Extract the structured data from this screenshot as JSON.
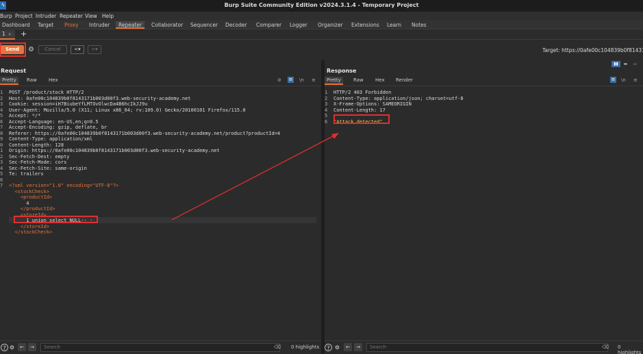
{
  "window": {
    "title": "Burp Suite Community Edition v2024.3.1.4 - Temporary Project"
  },
  "menu": [
    "Burp",
    "Project",
    "Intruder",
    "Repeater",
    "View",
    "Help"
  ],
  "tool_tabs": [
    "Dashboard",
    "Target",
    "Proxy",
    "Intruder",
    "Repeater",
    "Collaborator",
    "Sequencer",
    "Decoder",
    "Comparer",
    "Logger",
    "Organizer",
    "Extensions",
    "Learn",
    "Notes"
  ],
  "repeater": {
    "tab_label": "1",
    "tab_close": "×",
    "new_tab": "+"
  },
  "toolbar": {
    "send_label": "Send",
    "cancel_label": "Cancel",
    "back_label": "<▾",
    "forward_label": ">▾",
    "target": "Target: https://0afe00c104839b0f8143171b003"
  },
  "request": {
    "title": "Request",
    "tabs": [
      "Pretty",
      "Raw",
      "Hex"
    ],
    "lines": [
      {
        "n": "1",
        "t": "POST /product/stock HTTP/2"
      },
      {
        "n": "2",
        "t": "Host: 0afe00c104839b0f8143171b003d00f3.web-security-academy.net"
      },
      {
        "n": "3",
        "t": "Cookie: session=iH7BiubeYfLMTOvOlwcDa4B6hcIkJJ9u"
      },
      {
        "n": "4",
        "t": "User-Agent: Mozilla/5.0 (X11; Linux x86_64; rv:109.0) Gecko/20100101 Firefox/115.0"
      },
      {
        "n": "5",
        "t": "Accept: */*"
      },
      {
        "n": "6",
        "t": "Accept-Language: en-US,en;q=0.5"
      },
      {
        "n": "7",
        "t": "Accept-Encoding: gzip, deflate, br"
      },
      {
        "n": "8",
        "t": "Referer: https://0afe00c104839b0f8143171b003d00f3.web-security-academy.net/product?productId=4"
      },
      {
        "n": "9",
        "t": "Content-Type: application/xml"
      },
      {
        "n": "0",
        "t": "Content-Length: 128"
      },
      {
        "n": "1",
        "t": "Origin: https://0afe00c104839b0f8143171b003d00f3.web-security-academy.net"
      },
      {
        "n": "2",
        "t": "Sec-Fetch-Dest: empty"
      },
      {
        "n": "3",
        "t": "Sec-Fetch-Mode: cors"
      },
      {
        "n": "4",
        "t": "Sec-Fetch-Site: same-origin"
      },
      {
        "n": "5",
        "t": "Te: trailers"
      },
      {
        "n": "6",
        "t": ""
      },
      {
        "n": "7",
        "t": "<?xml version=\"1.0\" encoding=\"UTF-8\"?>"
      },
      {
        "n": "",
        "t": "  <stockCheck>"
      },
      {
        "n": "",
        "t": "    <productId>"
      },
      {
        "n": "",
        "t": "      4"
      },
      {
        "n": "",
        "t": "    </productId>"
      },
      {
        "n": "",
        "t": "    <storeId>"
      },
      {
        "n": "",
        "t": "      1 union select NULL-- -"
      },
      {
        "n": "",
        "t": "    </storeId>"
      },
      {
        "n": "",
        "t": "  </stockCheck>"
      }
    ]
  },
  "response": {
    "title": "Response",
    "tabs": [
      "Pretty",
      "Raw",
      "Hex",
      "Render"
    ],
    "lines": [
      {
        "n": "1",
        "t": "HTTP/2 403 Forbidden"
      },
      {
        "n": "2",
        "t": "Content-Type: application/json; charset=utf-8"
      },
      {
        "n": "3",
        "t": "X-Frame-Options: SAMEORIGIN"
      },
      {
        "n": "4",
        "t": "Content-Length: 17"
      },
      {
        "n": "5",
        "t": ""
      },
      {
        "n": "6",
        "t": "\"Attack detected\""
      }
    ]
  },
  "bottom": {
    "search_placeholder": "Search",
    "highlights": "0 highlights"
  },
  "colors": {
    "accent": "#e8743b",
    "annotation_red": "#e03030",
    "header_value_green": "#d6d648"
  }
}
